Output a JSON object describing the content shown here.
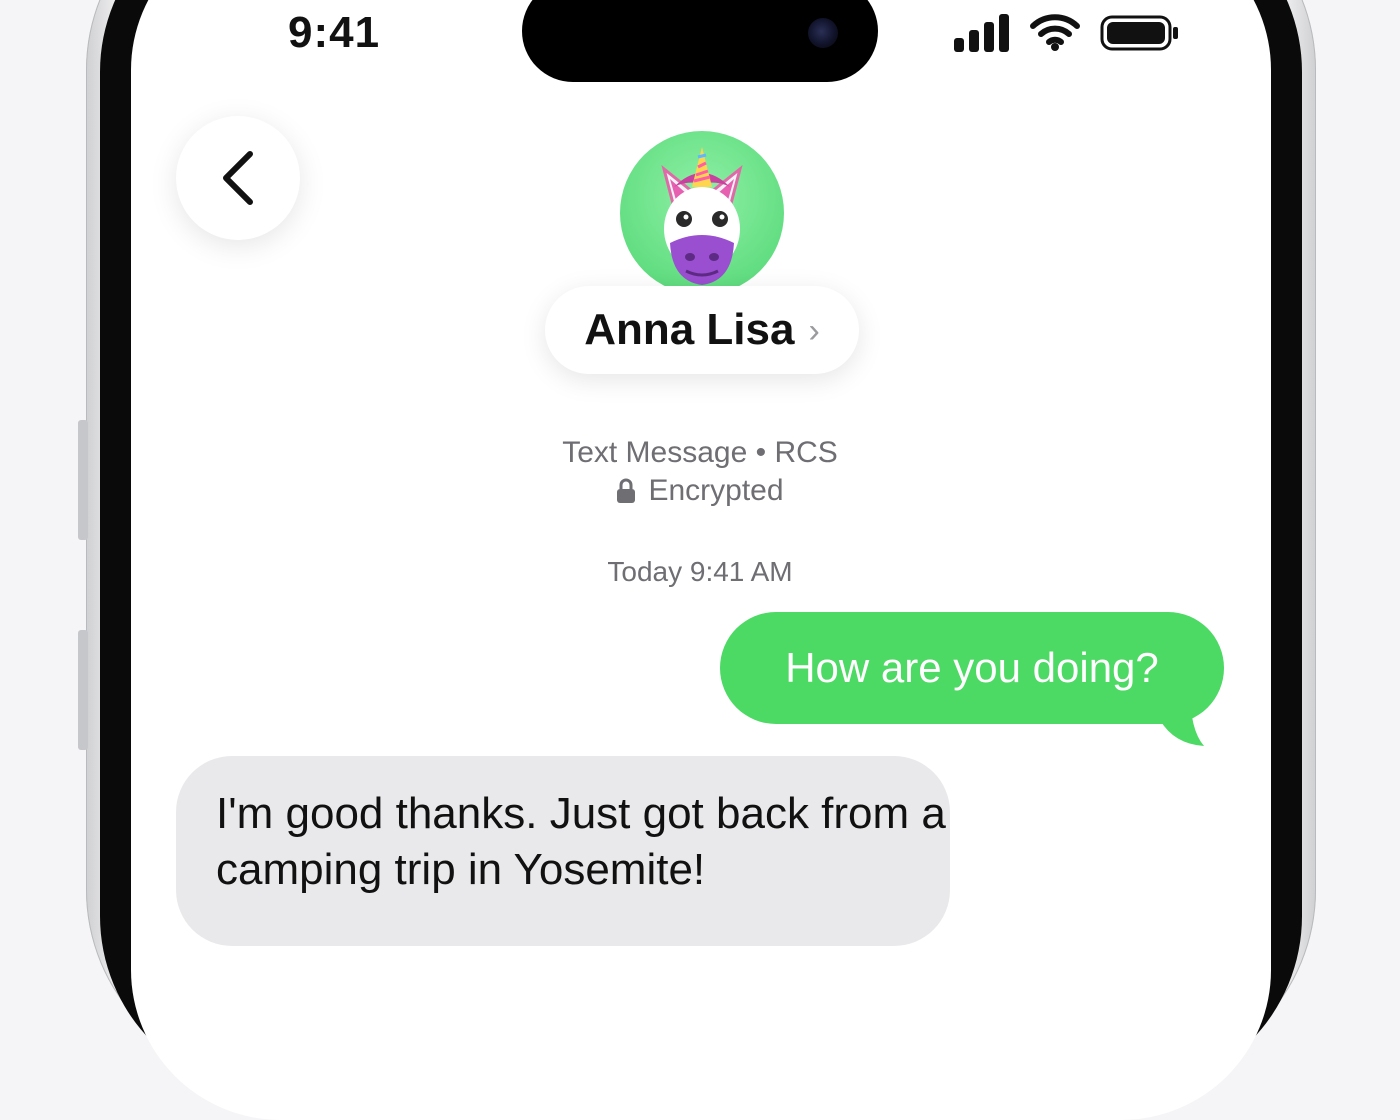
{
  "status_bar": {
    "time": "9:41",
    "icons": [
      "signal-icon",
      "wifi-icon",
      "battery-icon"
    ]
  },
  "header": {
    "back_icon": "chevron-left-icon",
    "contact_name": "Anna Lisa",
    "name_chevron": "›",
    "avatar": "unicorn-memoji-avatar"
  },
  "conversation_info": {
    "line1": "Text Message • RCS",
    "line2": "Encrypted",
    "lock_icon": "lock-icon"
  },
  "thread": {
    "timestamp": "Today 9:41 AM",
    "messages": [
      {
        "direction": "outgoing",
        "text": "How are you doing?"
      },
      {
        "direction": "incoming",
        "text": "I'm good thanks. Just got back from a camping trip in Yosemite!"
      }
    ]
  },
  "colors": {
    "outgoing_bubble": "#4cd964",
    "incoming_bubble": "#e9e9eb",
    "avatar_bg": "#63de82",
    "meta_text": "#6e6e73"
  }
}
